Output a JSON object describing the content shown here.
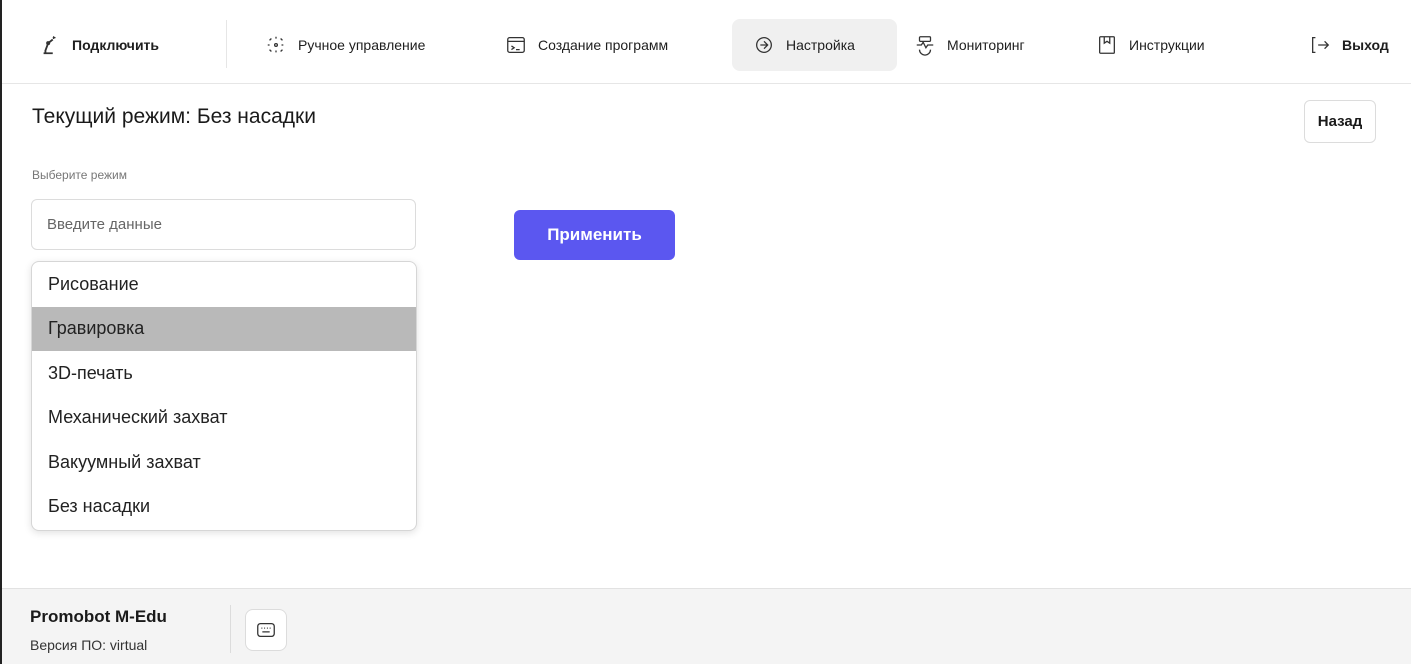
{
  "nav": {
    "connect": "Подключить",
    "manual": "Ручное управление",
    "programs": "Создание программ",
    "settings": "Настройка",
    "monitoring": "Мониторинг",
    "instructions": "Инструкции",
    "logout": "Выход"
  },
  "main": {
    "title": "Текущий режим: Без насадки",
    "back": "Назад",
    "select_label": "Выберите режим",
    "input_placeholder": "Введите данные",
    "apply": "Применить",
    "options": [
      "Рисование",
      "Гравировка",
      "3D-печать",
      "Механический захват",
      "Вакуумный захват",
      "Без насадки"
    ],
    "highlighted_option": "Гравировка"
  },
  "footer": {
    "product": "Promobot M-Edu",
    "version": "Версия ПО: virtual"
  },
  "colors": {
    "accent": "#5b57f0",
    "active_nav_bg": "#f0f0f0",
    "highlight": "#b9b9b9"
  }
}
